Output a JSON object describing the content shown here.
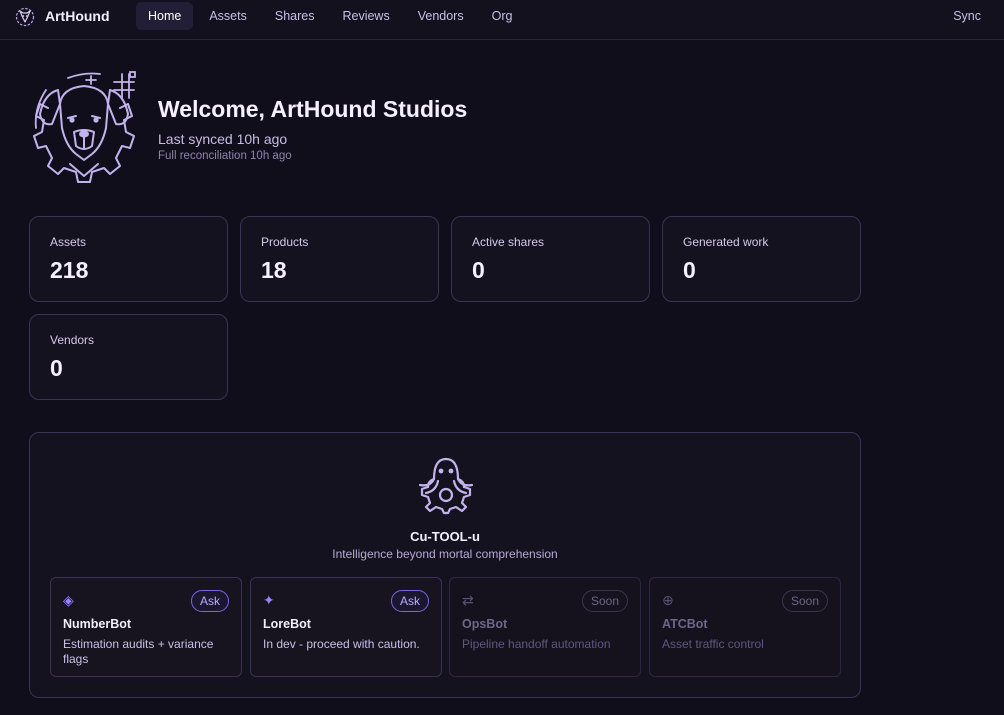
{
  "app": {
    "name": "ArtHound"
  },
  "nav": {
    "items": [
      {
        "label": "Home",
        "active": true
      },
      {
        "label": "Assets",
        "active": false
      },
      {
        "label": "Shares",
        "active": false
      },
      {
        "label": "Reviews",
        "active": false
      },
      {
        "label": "Vendors",
        "active": false
      },
      {
        "label": "Org",
        "active": false
      }
    ],
    "sync_label": "Sync"
  },
  "welcome": {
    "title": "Welcome, ArtHound Studios",
    "last_synced": "Last synced 10h ago",
    "reconciliation": "Full reconciliation 10h ago"
  },
  "stats": [
    {
      "label": "Assets",
      "value": "218"
    },
    {
      "label": "Products",
      "value": "18"
    },
    {
      "label": "Active shares",
      "value": "0"
    },
    {
      "label": "Generated work",
      "value": "0"
    },
    {
      "label": "Vendors",
      "value": "0"
    }
  ],
  "assistant": {
    "name": "Cu-TOOL-u",
    "tagline": "Intelligence beyond mortal comprehension",
    "bots": [
      {
        "icon": "◈",
        "icon_name": "diamond-icon",
        "name": "NumberBot",
        "desc": "Estimation audits + variance flags",
        "badge": "Ask",
        "enabled": true
      },
      {
        "icon": "✦",
        "icon_name": "sparkle-icon",
        "name": "LoreBot",
        "desc": "In dev - proceed with caution.",
        "badge": "Ask",
        "enabled": true
      },
      {
        "icon": "⇄",
        "icon_name": "swap-arrows-icon",
        "name": "OpsBot",
        "desc": "Pipeline handoff automation",
        "badge": "Soon",
        "enabled": false
      },
      {
        "icon": "⊕",
        "icon_name": "crosshair-icon",
        "name": "ATCBot",
        "desc": "Asset traffic control",
        "badge": "Soon",
        "enabled": false
      }
    ]
  },
  "colors": {
    "background": "#110e1c",
    "accent": "#9a84ff",
    "border": "#3a3356"
  }
}
